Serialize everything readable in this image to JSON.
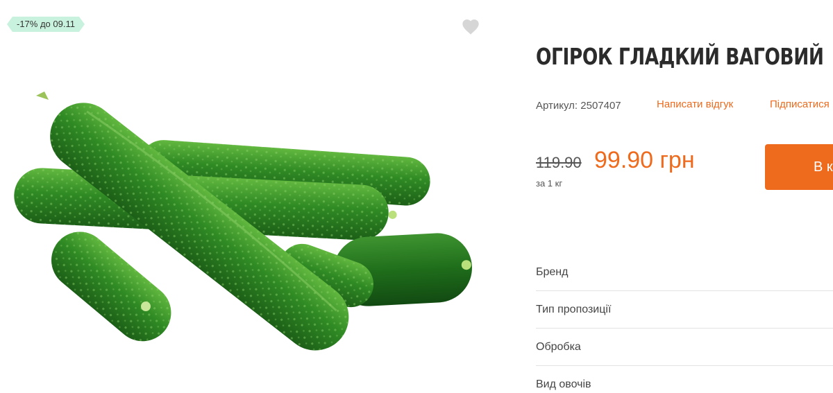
{
  "badge": {
    "discount": "-17% до 09.11"
  },
  "product": {
    "title": "ОГІРОК ГЛАДКИЙ ВАГОВИЙ",
    "sku_label": "Артикул: 2507407",
    "review_link": "Написати відгук",
    "subscribe_link": "Підписатися"
  },
  "price": {
    "old": "119.90",
    "current": "99.90 грн",
    "unit": "за 1 кг"
  },
  "cart": {
    "label": "В кошик"
  },
  "attributes": [
    {
      "label": "Бренд"
    },
    {
      "label": "Тип пропозиції"
    },
    {
      "label": "Обробка"
    },
    {
      "label": "Вид овочів"
    }
  ],
  "colors": {
    "accent": "#ee6a1d",
    "badge_bg": "#c9f2de"
  },
  "icons": {
    "wishlist": "heart-icon"
  }
}
